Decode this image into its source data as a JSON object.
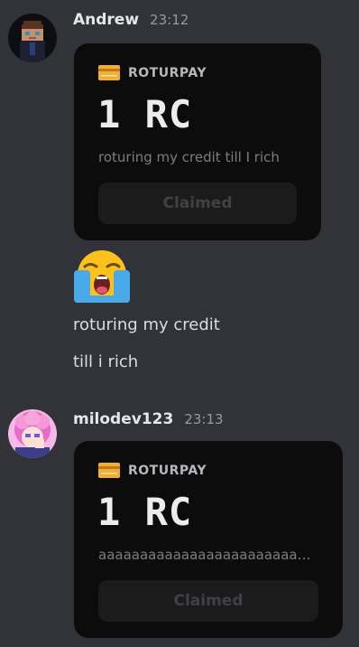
{
  "messages": [
    {
      "username": "Andrew",
      "timestamp": "23:12",
      "card": {
        "brand": "ROTURPAY",
        "amount": "1 RC",
        "note": "roturing my credit till I rich",
        "button": "Claimed"
      },
      "emoji": "loudly-crying-face",
      "lines": [
        "roturing my credit",
        "till i rich"
      ]
    },
    {
      "username": "milodev123",
      "timestamp": "23:13",
      "card": {
        "brand": "ROTURPAY",
        "amount": "1 RC",
        "note": "aaaaaaaaaaaaaaaaaaaaaaaaa...",
        "button": "Claimed"
      }
    }
  ],
  "colors": {
    "background": "#313338",
    "card": "#0c0c0c",
    "button": "#1b1b1b",
    "card_icon": "#f0b132"
  }
}
